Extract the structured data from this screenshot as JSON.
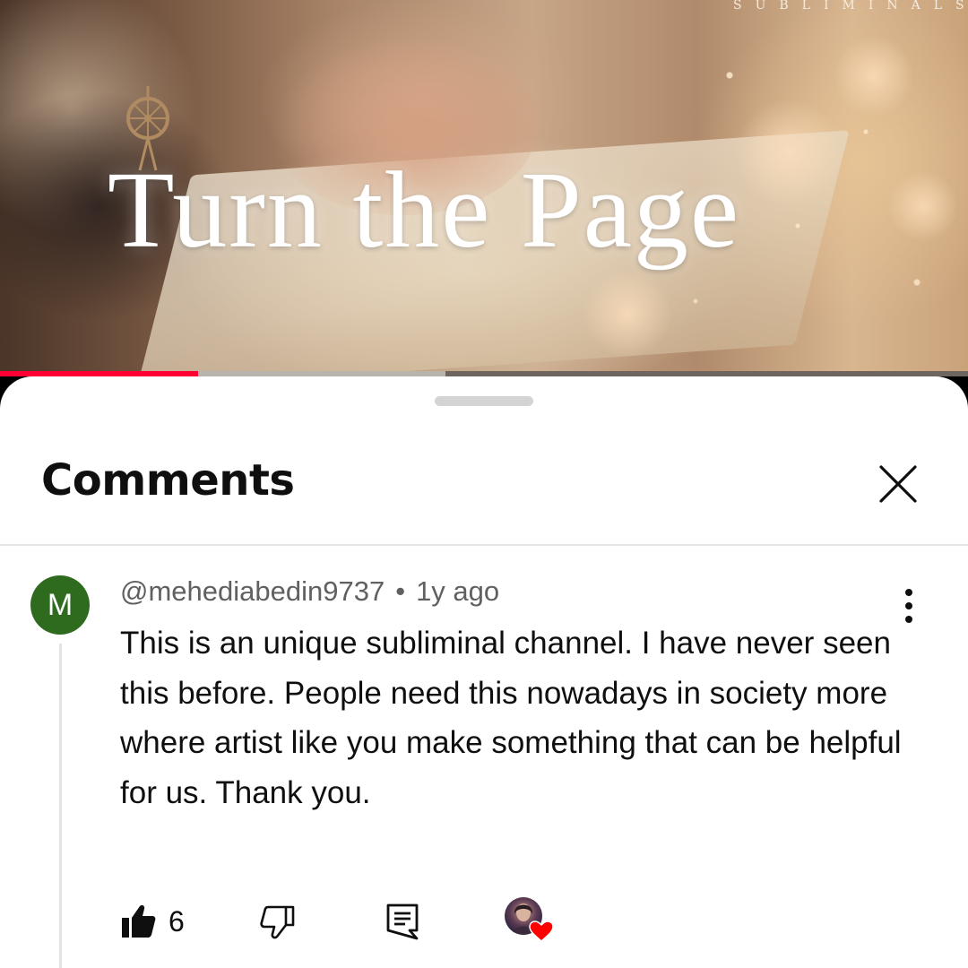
{
  "video": {
    "brand": "SUBLIMINALS",
    "headline": "Turn the Page",
    "progress_played_fraction": 0.205,
    "progress_buffered_fraction": 0.46
  },
  "comments_panel": {
    "title": "Comments",
    "close_icon": "close-icon"
  },
  "comment": {
    "avatar_letter": "M",
    "author": "@mehediabedin9737",
    "separator": "•",
    "time": "1y ago",
    "text": "This is an unique subliminal channel. I have never seen this before. People need this nowadays in society more where artist like you make something that can be helpful for us. Thank you.",
    "like_count": "6",
    "icons": [
      "thumbs-up-icon",
      "thumbs-down-icon",
      "reply-icon",
      "creator-heart-icon",
      "more-vertical-icon"
    ]
  },
  "colors": {
    "accent_red": "#ff0033",
    "avatar_green": "#2f6b1f",
    "meta_gray": "#606060",
    "text": "#0f0f0f"
  }
}
